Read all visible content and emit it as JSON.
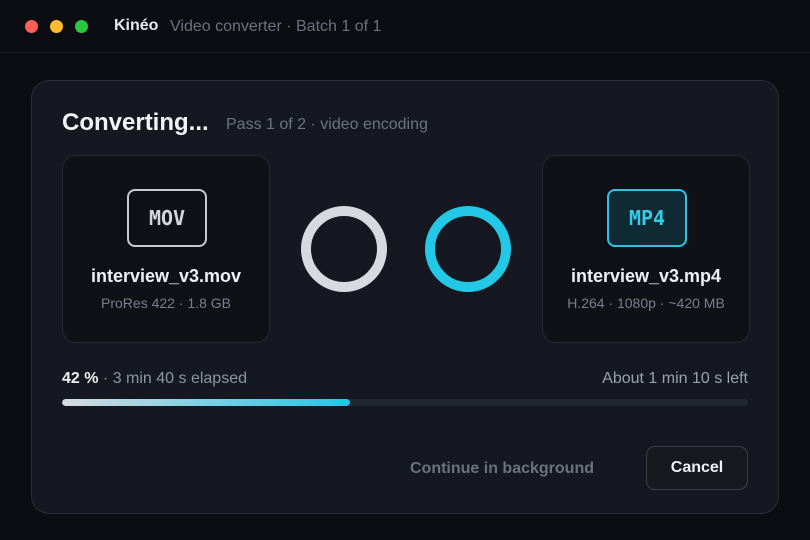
{
  "window": {
    "app_name": "Kinéo",
    "subtitle": "Video converter · Batch 1 of 1"
  },
  "dialog": {
    "title": "Converting...",
    "pass": "Pass 1 of 2 · video encoding"
  },
  "source": {
    "format": "MOV",
    "name": "interview_v3.mov",
    "meta": "ProRes 422 · 1.8 GB"
  },
  "destination": {
    "format": "MP4",
    "name": "interview_v3.mp4",
    "meta": "H.264 · 1080p · ~420 MB"
  },
  "progress": {
    "percent": 42,
    "percent_label": "42 %",
    "elapsed": " · 3 min 40 s elapsed",
    "remaining": "About 1 min 10 s left",
    "fill_gradient": [
      "#d7dae0",
      "#22c6e6"
    ]
  },
  "actions": {
    "background_label": "Continue in background",
    "cancel_label": "Cancel"
  },
  "colors": {
    "accent": "#22c8e6",
    "background": "#0b0d12",
    "card": "#151820"
  },
  "icons": {
    "source_ring": "ring-icon",
    "destination_ring": "ring-icon"
  }
}
